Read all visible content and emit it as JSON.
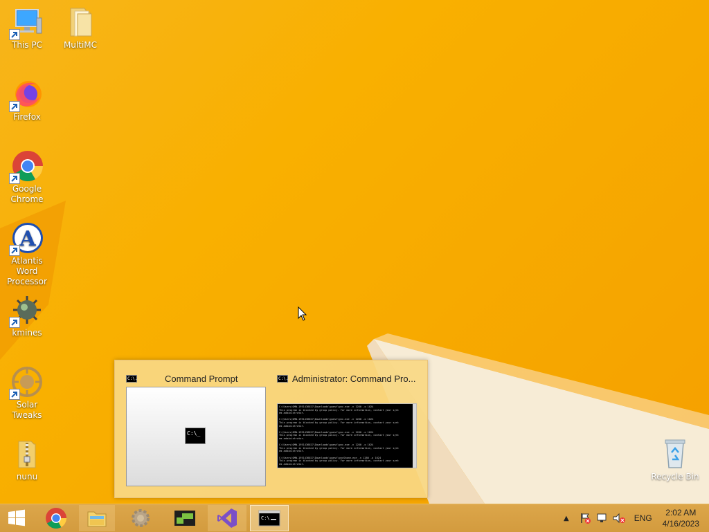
{
  "desktop": {
    "icons": [
      {
        "label": "This PC",
        "icon": "this-pc-icon"
      },
      {
        "label": "MultiMC",
        "icon": "folder-icon"
      },
      {
        "label": "Firefox",
        "icon": "firefox-icon"
      },
      {
        "label": "Google Chrome",
        "line1": "Google",
        "line2": "Chrome",
        "icon": "chrome-icon"
      },
      {
        "label": "Atlantis Word Processor",
        "line1": "Atlantis Word",
        "line2": "Processor",
        "icon": "atlantis-icon"
      },
      {
        "label": "kmines",
        "icon": "kmines-icon"
      },
      {
        "label": "Solar Tweaks",
        "icon": "solar-tweaks-icon"
      },
      {
        "label": "nunu",
        "icon": "zip-folder-icon"
      },
      {
        "label": "Recycle Bin",
        "icon": "recycle-bin-icon"
      }
    ]
  },
  "thumbnails": {
    "items": [
      {
        "title": "Command Prompt",
        "icon_text": "C:\\."
      },
      {
        "title": "Administrator:  Command Pro...",
        "icon_text": "C:\\."
      }
    ],
    "preview_icon_text": "C:\\_",
    "console_lines": [
      "C:\\Users\\OMW-1951436027\\Downloads\\guest\\gnc.exe -n 1280 -o 1024",
      "This program is blocked by group policy. For more information, contact your syst",
      "em administrator.",
      "",
      "C:\\Users\\OMW-1951436027\\Downloads\\guest\\gnc.exe -n 1280 -o 1024",
      "This program is blocked by group policy. For more information, contact your syst",
      "em administrator.",
      "",
      "C:\\Users\\OMW-1951436027\\Downloads\\guest\\gnc.exe -n 1280 -o 1024",
      "This program is blocked by group policy. For more information, contact your syst",
      "em administrator.",
      "",
      "C:\\Users\\OMW-1951436027\\Downloads\\guest\\gnc.exe -n 1280 -o 1024",
      "This program is blocked by group policy. For more information, contact your syst",
      "em administrator.",
      "",
      "C:\\Users\\OMW-1951436027\\Downloads\\guest\\gncShome.exe -n 1280 -o 1024",
      "This program is blocked by group policy. For more information, contact your syst",
      "em administrator.",
      "",
      "C:\\Users\\OMW-1951436027\\Downloads\\guest\\gnc.exe -n 1280 -o 1024_"
    ]
  },
  "taskbar": {
    "items": [
      {
        "name": "start",
        "icon": "windows-logo-icon"
      },
      {
        "name": "chrome",
        "icon": "chrome-icon"
      },
      {
        "name": "file-explorer",
        "icon": "file-explorer-icon"
      },
      {
        "name": "settings",
        "icon": "gear-icon"
      },
      {
        "name": "app-green",
        "icon": "green-app-icon"
      },
      {
        "name": "visual-studio",
        "icon": "visual-studio-icon"
      },
      {
        "name": "command-prompt",
        "icon": "command-prompt-icon"
      }
    ],
    "tray": {
      "language": "ENG",
      "time": "2:02 AM",
      "date": "4/16/2023"
    }
  },
  "colors": {
    "desktop": "#f8a800",
    "taskbar": "#d6a04a",
    "popup": "#f8d884"
  }
}
